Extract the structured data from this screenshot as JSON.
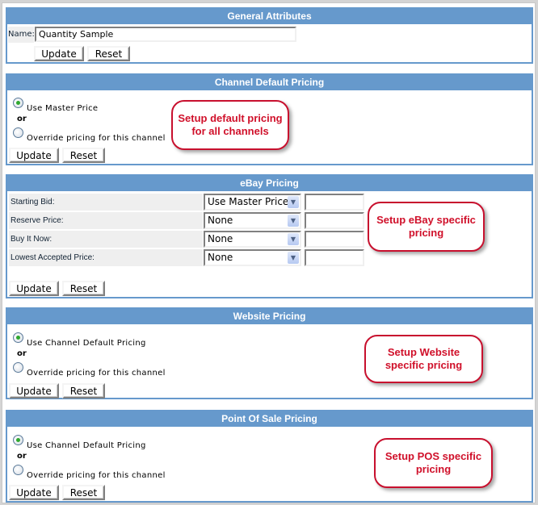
{
  "general": {
    "title": "General Attributes",
    "name_label": "Name:",
    "name_value": "Quantity Sample",
    "update": "Update",
    "reset": "Reset"
  },
  "channel": {
    "title": "Channel Default Pricing",
    "option1": "Use Master Price",
    "or": "or",
    "option2": "Override pricing for this channel",
    "selected": "option1",
    "update": "Update",
    "reset": "Reset",
    "callout": "Setup default pricing for all channels"
  },
  "ebay": {
    "title": "eBay Pricing",
    "rows": [
      {
        "label": "Starting Bid:",
        "select": "Use Master Price",
        "value": ""
      },
      {
        "label": "Reserve Price:",
        "select": "None",
        "value": ""
      },
      {
        "label": "Buy It Now:",
        "select": "None",
        "value": ""
      },
      {
        "label": "Lowest Accepted Price:",
        "select": "None",
        "value": ""
      }
    ],
    "update": "Update",
    "reset": "Reset",
    "callout": "Setup eBay specific pricing"
  },
  "website": {
    "title": "Website Pricing",
    "option1": "Use Channel Default Pricing",
    "or": "or",
    "option2": "Override pricing for this channel",
    "selected": "option1",
    "update": "Update",
    "reset": "Reset",
    "callout": "Setup Website specific pricing"
  },
  "pos": {
    "title": "Point Of Sale Pricing",
    "option1": "Use Channel Default Pricing",
    "or": "or",
    "option2": "Override pricing for this channel",
    "selected": "option1",
    "update": "Update",
    "reset": "Reset",
    "callout": "Setup POS specific pricing"
  },
  "colors": {
    "header": "#6699cc",
    "callout": "#d0102a"
  },
  "icons": {
    "select_arrow": "chevron-down-icon"
  }
}
